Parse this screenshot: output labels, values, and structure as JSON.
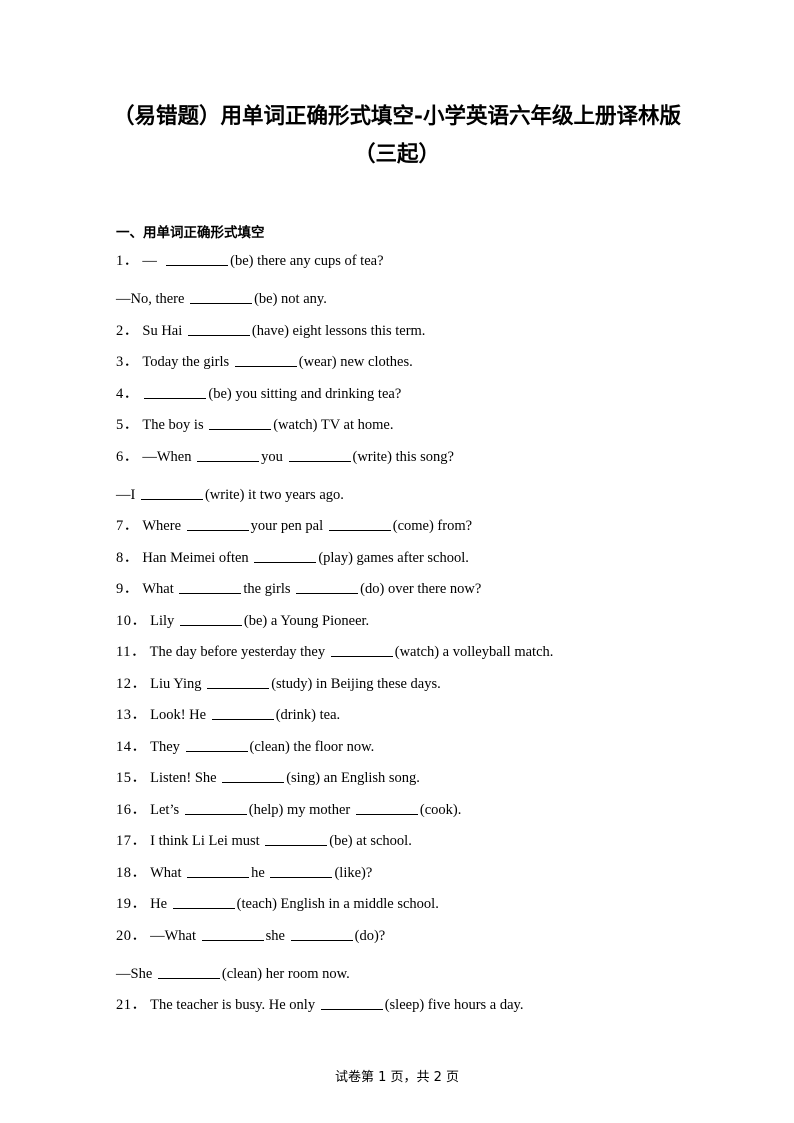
{
  "document": {
    "title_line1": "（易错题）用单词正确形式填空-小学英语六年级上册译林版",
    "title_line2": "（三起）",
    "section_heading": "一、用单词正确形式填空"
  },
  "footer": {
    "text": "试卷第 1 页，共 2 页"
  },
  "questions": [
    {
      "number": "1．",
      "spacing": "dialog",
      "parts": [
        {
          "type": "text",
          "value": "— "
        },
        {
          "type": "blank"
        },
        {
          "type": "text",
          "value": "(be) there any cups of tea?"
        }
      ]
    },
    {
      "number": "",
      "spacing": "normal",
      "parts": [
        {
          "type": "text",
          "value": "—No, there"
        },
        {
          "type": "blank"
        },
        {
          "type": "text",
          "value": "(be) not any."
        }
      ]
    },
    {
      "number": "2．",
      "spacing": "normal",
      "parts": [
        {
          "type": "text",
          "value": "Su Hai"
        },
        {
          "type": "blank"
        },
        {
          "type": "text",
          "value": "(have) eight lessons this term."
        }
      ]
    },
    {
      "number": "3．",
      "spacing": "normal",
      "parts": [
        {
          "type": "text",
          "value": "Today the girls"
        },
        {
          "type": "blank"
        },
        {
          "type": "text",
          "value": "(wear) new clothes."
        }
      ]
    },
    {
      "number": "4．",
      "spacing": "normal",
      "parts": [
        {
          "type": "blank"
        },
        {
          "type": "text",
          "value": "(be) you sitting and drinking tea?"
        }
      ]
    },
    {
      "number": "5．",
      "spacing": "normal",
      "parts": [
        {
          "type": "text",
          "value": "The boy is"
        },
        {
          "type": "blank"
        },
        {
          "type": "text",
          "value": "(watch) TV at home."
        }
      ]
    },
    {
      "number": "6．",
      "spacing": "dialog",
      "parts": [
        {
          "type": "text",
          "value": "—When"
        },
        {
          "type": "blank"
        },
        {
          "type": "text",
          "value": "you"
        },
        {
          "type": "blank"
        },
        {
          "type": "text",
          "value": "(write) this song?"
        }
      ]
    },
    {
      "number": "",
      "spacing": "normal",
      "parts": [
        {
          "type": "text",
          "value": "—I"
        },
        {
          "type": "blank"
        },
        {
          "type": "text",
          "value": "(write) it two years ago."
        }
      ]
    },
    {
      "number": "7．",
      "spacing": "normal",
      "parts": [
        {
          "type": "text",
          "value": "Where"
        },
        {
          "type": "blank"
        },
        {
          "type": "text",
          "value": "your pen pal"
        },
        {
          "type": "blank"
        },
        {
          "type": "text",
          "value": "(come) from?"
        }
      ]
    },
    {
      "number": "8．",
      "spacing": "normal",
      "parts": [
        {
          "type": "text",
          "value": "Han Meimei often"
        },
        {
          "type": "blank"
        },
        {
          "type": "text",
          "value": "(play) games after school."
        }
      ]
    },
    {
      "number": "9．",
      "spacing": "normal",
      "parts": [
        {
          "type": "text",
          "value": "What"
        },
        {
          "type": "blank"
        },
        {
          "type": "text",
          "value": "the girls"
        },
        {
          "type": "blank"
        },
        {
          "type": "text",
          "value": "(do) over there now?"
        }
      ]
    },
    {
      "number": "10．",
      "spacing": "normal",
      "parts": [
        {
          "type": "text",
          "value": "Lily"
        },
        {
          "type": "blank"
        },
        {
          "type": "text",
          "value": "(be) a Young Pioneer."
        }
      ]
    },
    {
      "number": "11．",
      "spacing": "normal",
      "parts": [
        {
          "type": "text",
          "value": "The day before yesterday they"
        },
        {
          "type": "blank"
        },
        {
          "type": "text",
          "value": "(watch) a volleyball match."
        }
      ]
    },
    {
      "number": "12．",
      "spacing": "normal",
      "parts": [
        {
          "type": "text",
          "value": "Liu Ying"
        },
        {
          "type": "blank"
        },
        {
          "type": "text",
          "value": "(study) in Beijing these days."
        }
      ]
    },
    {
      "number": "13．",
      "spacing": "normal",
      "parts": [
        {
          "type": "text",
          "value": "Look! He"
        },
        {
          "type": "blank"
        },
        {
          "type": "text",
          "value": "(drink) tea."
        }
      ]
    },
    {
      "number": "14．",
      "spacing": "normal",
      "parts": [
        {
          "type": "text",
          "value": "They"
        },
        {
          "type": "blank"
        },
        {
          "type": "text",
          "value": "(clean) the floor now."
        }
      ]
    },
    {
      "number": "15．",
      "spacing": "normal",
      "parts": [
        {
          "type": "text",
          "value": "Listen! She"
        },
        {
          "type": "blank"
        },
        {
          "type": "text",
          "value": "(sing) an English song."
        }
      ]
    },
    {
      "number": "16．",
      "spacing": "normal",
      "parts": [
        {
          "type": "text",
          "value": "Let’s"
        },
        {
          "type": "blank"
        },
        {
          "type": "text",
          "value": "(help) my mother"
        },
        {
          "type": "blank"
        },
        {
          "type": "text",
          "value": "(cook)."
        }
      ]
    },
    {
      "number": "17．",
      "spacing": "normal",
      "parts": [
        {
          "type": "text",
          "value": "I think Li Lei must"
        },
        {
          "type": "blank"
        },
        {
          "type": "text",
          "value": "(be) at school."
        }
      ]
    },
    {
      "number": "18．",
      "spacing": "normal",
      "parts": [
        {
          "type": "text",
          "value": "What"
        },
        {
          "type": "blank"
        },
        {
          "type": "text",
          "value": "he"
        },
        {
          "type": "blank"
        },
        {
          "type": "text",
          "value": "(like)?"
        }
      ]
    },
    {
      "number": "19．",
      "spacing": "normal",
      "parts": [
        {
          "type": "text",
          "value": "He"
        },
        {
          "type": "blank"
        },
        {
          "type": "text",
          "value": "(teach) English in a middle school."
        }
      ]
    },
    {
      "number": "20．",
      "spacing": "dialog",
      "parts": [
        {
          "type": "text",
          "value": "—What"
        },
        {
          "type": "blank"
        },
        {
          "type": "text",
          "value": "she"
        },
        {
          "type": "blank"
        },
        {
          "type": "text",
          "value": "(do)?"
        }
      ]
    },
    {
      "number": "",
      "spacing": "normal",
      "parts": [
        {
          "type": "text",
          "value": "—She"
        },
        {
          "type": "blank"
        },
        {
          "type": "text",
          "value": "(clean) her room now."
        }
      ]
    },
    {
      "number": "21．",
      "spacing": "normal",
      "parts": [
        {
          "type": "text",
          "value": "The teacher is busy. He only"
        },
        {
          "type": "blank"
        },
        {
          "type": "text",
          "value": "(sleep) five hours a day."
        }
      ]
    }
  ]
}
